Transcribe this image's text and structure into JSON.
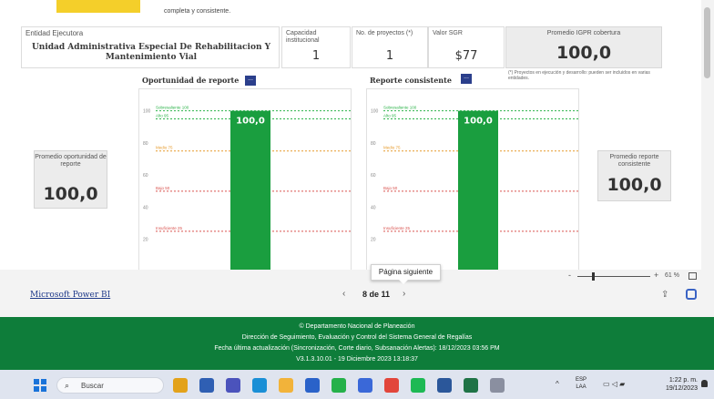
{
  "top_note": "completa y consistente.",
  "top_badge": "",
  "entidad": {
    "label": "Entidad Ejecutora",
    "name": "Unidad Administrativa Especial De Rehabilitacion Y Mantenimiento Vial"
  },
  "capacidad": {
    "label": "Capacidad institucional",
    "value": "1"
  },
  "proyectos": {
    "label": "No. de proyectos (*)",
    "value": "1"
  },
  "valor_sgr": {
    "label": "Valor SGR",
    "value": "$77"
  },
  "igpr": {
    "label": "Promedio IGPR cobertura",
    "value": "100,0"
  },
  "footnote": "(*) Proyectos en ejecución y desarrollo: pueden ser incluidos en varias entidades.",
  "chart_oportunidad_title": "Oportunidad de reporte",
  "chart_consistente_title": "Reporte consistente",
  "info_button_glyph": "...",
  "promedio_oportunidad": {
    "label": "Promedio oportunidad de reporte",
    "value": "100,0"
  },
  "promedio_consistente": {
    "label": "Promedio reporte consistente",
    "value": "100,0"
  },
  "chart_data": [
    {
      "type": "bar",
      "categories": [
        ""
      ],
      "values": [
        100
      ],
      "data_labels": [
        "100,0"
      ],
      "ylim": [
        0,
        110
      ],
      "y_ticks": [
        "100",
        "80",
        "60",
        "40",
        "20"
      ],
      "reference_lines": [
        {
          "label": "Sobresaliente 100",
          "value": 100,
          "color": "#2db34a"
        },
        {
          "label": "Alto 95",
          "value": 95,
          "color": "#2db34a"
        },
        {
          "label": "Medio 75",
          "value": 75,
          "color": "#e69a2b"
        },
        {
          "label": "Bajo 50",
          "value": 50,
          "color": "#d9534f"
        },
        {
          "label": "Insuficiente 25",
          "value": 25,
          "color": "#d9534f"
        }
      ],
      "bar_color": "#1a9e3f"
    },
    {
      "type": "bar",
      "categories": [
        ""
      ],
      "values": [
        100
      ],
      "data_labels": [
        "100,0"
      ],
      "ylim": [
        0,
        110
      ],
      "y_ticks": [
        "100",
        "80",
        "60",
        "40",
        "20"
      ],
      "reference_lines": [
        {
          "label": "Sobresaliente 100",
          "value": 100,
          "color": "#2db34a"
        },
        {
          "label": "Alto 95",
          "value": 95,
          "color": "#2db34a"
        },
        {
          "label": "Medio 75",
          "value": 75,
          "color": "#e69a2b"
        },
        {
          "label": "Bajo 50",
          "value": 50,
          "color": "#d9534f"
        },
        {
          "label": "Insuficiente 25",
          "value": 25,
          "color": "#d9534f"
        }
      ],
      "bar_color": "#1a9e3f"
    }
  ],
  "pbi": {
    "link": "Microsoft Power BI",
    "page": "8 de 11",
    "prev": "‹",
    "next": "›",
    "tooltip": "Página siguiente",
    "zoom": "61 %",
    "zoom_minus": "-",
    "zoom_plus": "+"
  },
  "footer": {
    "line1": "© Departamento Nacional de Planeación",
    "line2": "Dirección de Seguimiento, Evaluación y Control del Sistema General de Regalías",
    "line3": "Fecha última actualización (Sincronización, Corte diario, Subsanación Alertas): 18/12/2023 03:56 PM",
    "line4": "V3.1.3.10.01 - 19 Diciembre 2023 13:18:37"
  },
  "taskbar": {
    "search_placeholder": "Buscar",
    "lang_top": "ESP",
    "lang_bottom": "LAA",
    "time": "1:22 p. m.",
    "date": "19/12/2023",
    "apps": [
      "file-explorer-icon",
      "taskview-icon",
      "teams-icon",
      "edge-icon",
      "files-icon",
      "mail-icon",
      "whatsapp-icon",
      "notes-icon",
      "chrome-icon",
      "spotify-icon",
      "word-icon",
      "excel-icon",
      "photos-icon"
    ],
    "app_colors": [
      "#e3a21a",
      "#2f5fb3",
      "#4b53bc",
      "#1a8fd6",
      "#f2b33a",
      "#2a62c9",
      "#25b14a",
      "#3a68d8",
      "#e2463b",
      "#1db954",
      "#2b579a",
      "#1f7346",
      "#8a8fa0"
    ]
  },
  "colors": {
    "accent_green": "#0e7d3a",
    "bar_green": "#1a9e3f",
    "info_blue": "#2b3f8c"
  }
}
